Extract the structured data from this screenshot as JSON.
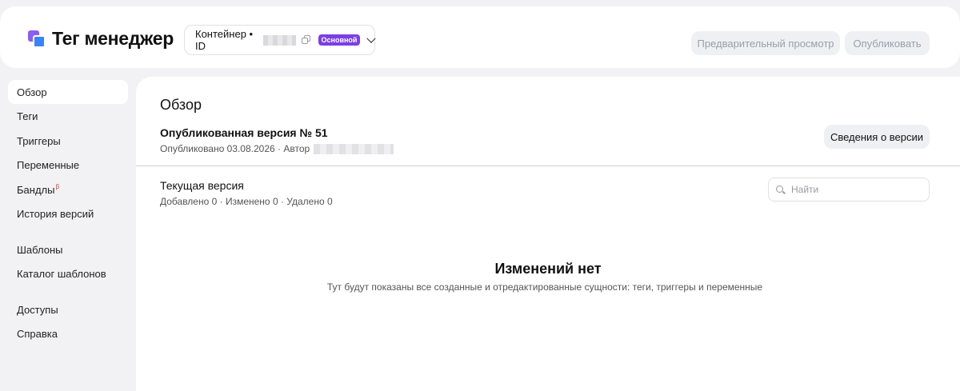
{
  "header": {
    "app_title": "Тег менеджер",
    "container_label": "Контейнер • ID",
    "container_badge": "Основной",
    "preview_button": "Предварительный просмотр",
    "publish_button": "Опубликовать"
  },
  "sidebar": {
    "items": [
      {
        "label": "Обзор",
        "active": true
      },
      {
        "label": "Теги"
      },
      {
        "label": "Триггеры"
      },
      {
        "label": "Переменные"
      },
      {
        "label": "Бандлы",
        "badge": "β"
      },
      {
        "label": "История версий"
      },
      {
        "label": "Шаблоны"
      },
      {
        "label": "Каталог шаблонов"
      },
      {
        "label": "Доступы"
      },
      {
        "label": "Справка"
      }
    ]
  },
  "main": {
    "title": "Обзор",
    "published_title": "Опубликованная версия № 51",
    "published_meta": "Опубликовано 03.08.2026 · Автор",
    "version_details_button": "Сведения о версии",
    "current_title": "Текущая версия",
    "current_meta": "Добавлено 0 · Изменено 0 · Удалено 0",
    "search_placeholder": "Найти",
    "empty_title": "Изменений нет",
    "empty_text": "Тут будут показаны все созданные и отредактированные сущности: теги, триггеры и переменные"
  },
  "colors": {
    "accent": "#7b3fe4",
    "background": "#f2f2f5"
  }
}
